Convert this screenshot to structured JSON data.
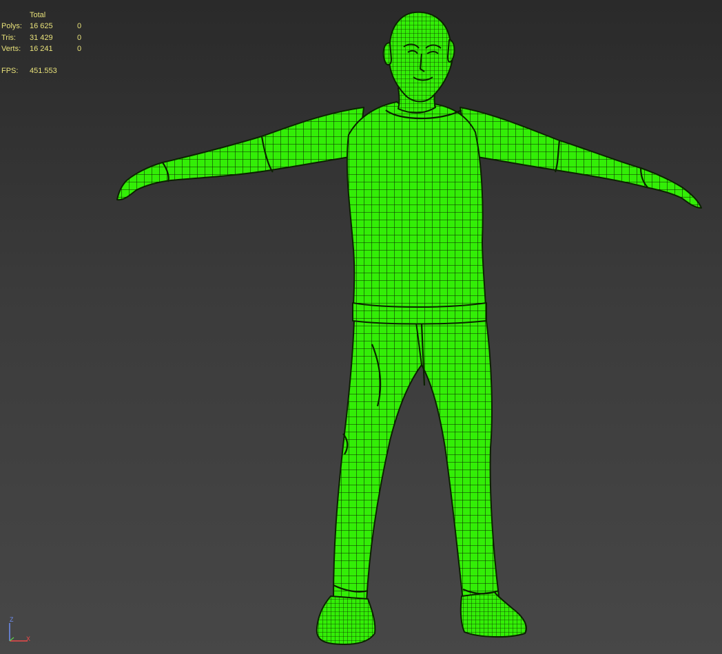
{
  "stats": {
    "header": "Total",
    "rows": [
      {
        "label": "Polys:",
        "total": "16 625",
        "selected": "0"
      },
      {
        "label": "Tris:",
        "total": "31 429",
        "selected": "0"
      },
      {
        "label": "Verts:",
        "total": "16 241",
        "selected": "0"
      }
    ],
    "fps_label": "FPS:",
    "fps_value": "451.553",
    "text_color": "#e9e27a"
  },
  "model": {
    "fill_color": "#33ee07",
    "wire_color": "#0b2200"
  },
  "axis_gizmo": {
    "z_label": "Z",
    "x_label": "X",
    "z_color": "#6f8ff2",
    "x_color": "#ee4a4a"
  }
}
